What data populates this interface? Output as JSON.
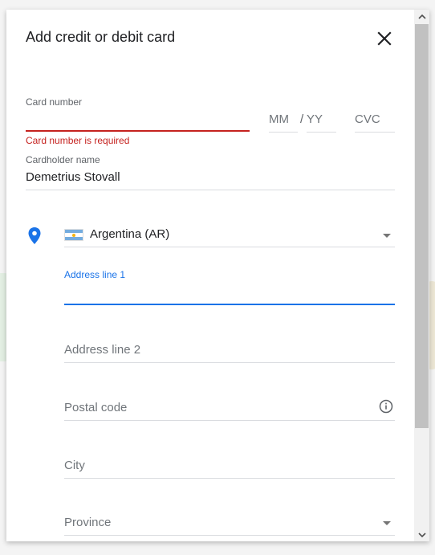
{
  "dialog": {
    "title": "Add credit or debit card"
  },
  "card": {
    "number_label": "Card number",
    "number_error": "Card number is required",
    "month_placeholder": "MM",
    "separator": "/",
    "year_placeholder": "YY",
    "cvc_placeholder": "CVC",
    "cardholder_label": "Cardholder name",
    "cardholder_value": "Demetrius Stovall"
  },
  "address": {
    "country_value": "Argentina (AR)",
    "line1_label": "Address line 1",
    "line2_placeholder": "Address line 2",
    "postal_placeholder": "Postal code",
    "city_placeholder": "City",
    "province_placeholder": "Province"
  },
  "colors": {
    "error": "#c5221f",
    "focus": "#1a73e8",
    "flag_blue": "#74acdf",
    "flag_sun": "#f6b40e"
  },
  "icons": {
    "close": "close-icon",
    "location": "location-pin-icon",
    "flag": "argentina-flag-icon",
    "info": "info-icon",
    "dropdown": "chevron-down-icon"
  }
}
